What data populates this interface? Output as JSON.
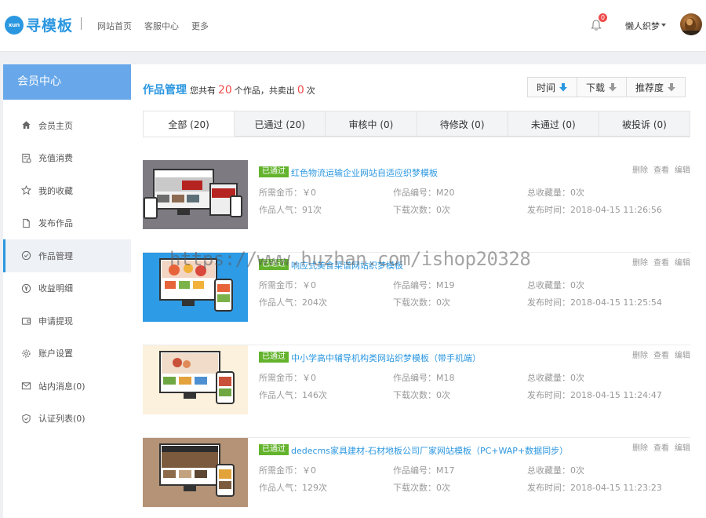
{
  "header": {
    "logo_badge": "xun",
    "logo_text": "寻模板",
    "nav": [
      "网站首页",
      "客服中心",
      "更多"
    ],
    "notification_count": "0",
    "username": "懒人织梦"
  },
  "sidebar": {
    "title": "会员中心",
    "items": [
      {
        "label": "会员主页",
        "icon": "home-icon"
      },
      {
        "label": "充值消费",
        "icon": "recharge-icon"
      },
      {
        "label": "我的收藏",
        "icon": "star-icon"
      },
      {
        "label": "发布作品",
        "icon": "file-icon"
      },
      {
        "label": "作品管理",
        "icon": "check-circle-icon",
        "active": true
      },
      {
        "label": "收益明细",
        "icon": "yen-icon"
      },
      {
        "label": "申请提现",
        "icon": "wallet-icon"
      },
      {
        "label": "账户设置",
        "icon": "gear-icon"
      },
      {
        "label": "站内消息(0)",
        "icon": "mail-icon"
      },
      {
        "label": "认证列表(0)",
        "icon": "shield-icon"
      }
    ]
  },
  "main": {
    "title": "作品管理",
    "summary_prefix": "您共有",
    "total_works": "20",
    "summary_mid": "个作品，共卖出",
    "sold": "0",
    "summary_suffix": "次",
    "sort": [
      {
        "label": "时间",
        "color": "#2b97e0"
      },
      {
        "label": "下载",
        "color": "#999999"
      },
      {
        "label": "推荐度",
        "color": "#999999"
      }
    ],
    "tabs": [
      "全部 (20)",
      "已通过 (20)",
      "审核中 (0)",
      "待修改 (0)",
      "未通过 (0)",
      "被投诉 (0)"
    ],
    "actions": [
      "删除",
      "查看",
      "编辑"
    ],
    "labels": {
      "price": "所需金币：",
      "popularity": "作品人气：",
      "code": "作品编号：",
      "downloads": "下载次数：",
      "favorites": "总收藏量：",
      "published": "发布时间："
    },
    "works": [
      {
        "status": "已通过",
        "title": "红色物流运输企业网站自适应织梦模板",
        "price": "￥0",
        "popularity": "91次",
        "code": "M20",
        "downloads": "0次",
        "favorites": "0次",
        "published": "2018-04-15 11:26:56",
        "thumb": "gray"
      },
      {
        "status": "已通过",
        "title": "响应式美食菜谱网站织梦模板",
        "price": "￥0",
        "popularity": "204次",
        "code": "M19",
        "downloads": "0次",
        "favorites": "0次",
        "published": "2018-04-15 11:25:54",
        "thumb": "blue"
      },
      {
        "status": "已通过",
        "title": "中小学高中辅导机构类网站织梦模板（带手机端）",
        "price": "￥0",
        "popularity": "146次",
        "code": "M18",
        "downloads": "0次",
        "favorites": "0次",
        "published": "2018-04-15 11:24:47",
        "thumb": "cream"
      },
      {
        "status": "已通过",
        "title": "dedecms家具建材-石材地板公司厂家网站模板（PC+WAP+数据同步）",
        "price": "￥0",
        "popularity": "129次",
        "code": "M17",
        "downloads": "0次",
        "favorites": "0次",
        "published": "2018-04-15 11:23:23",
        "thumb": "tan"
      }
    ]
  },
  "watermark": "https://www.huzhan.com/ishop20328",
  "colors": {
    "accent": "#2b97e0",
    "sidebar_header": "#68a8ea",
    "status_green": "#63b32c",
    "count_red": "#f04a4a"
  }
}
